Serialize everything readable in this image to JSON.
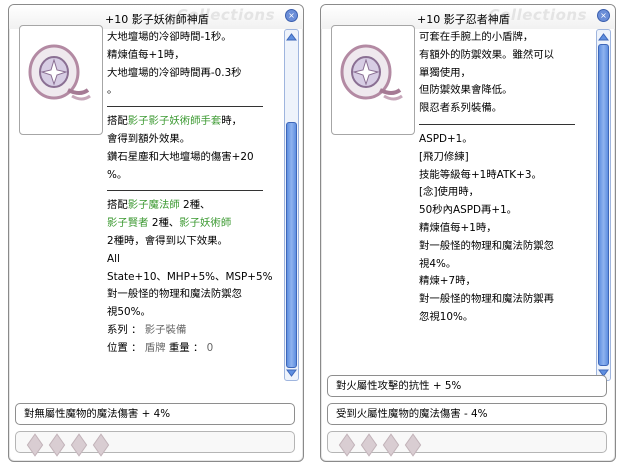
{
  "left": {
    "title": "+10 影子妖術師神盾",
    "watermark": "Collections",
    "lines": [
      {
        "t": "大地壇場的冷卻時間-1秒。"
      },
      {
        "t": "精煉值每+1時，"
      },
      {
        "t": "大地壇場的冷卻時間再-0.3秒"
      },
      {
        "t": "。"
      },
      {
        "hr": true
      },
      {
        "parts": [
          {
            "t": "搭配"
          },
          {
            "t": "影子影子妖術師手套",
            "c": "green"
          },
          {
            "t": "時，"
          }
        ]
      },
      {
        "t": "會得到額外效果。"
      },
      {
        "t": "鑽石星塵和大地壇場的傷害+20"
      },
      {
        "t": "%。"
      },
      {
        "hr": true
      },
      {
        "parts": [
          {
            "t": "搭配"
          },
          {
            "t": "影子魔法師",
            "c": "green"
          },
          {
            "t": " 2種、"
          }
        ]
      },
      {
        "parts": [
          {
            "t": "影子賢者",
            "c": "green"
          },
          {
            "t": " 2種、"
          },
          {
            "t": "影子妖術師",
            "c": "green"
          }
        ]
      },
      {
        "t": "2種時，會得到以下效果。"
      },
      {
        "t": "All"
      },
      {
        "t": "State+10、MHP+5%、MSP+5%。"
      },
      {
        "t": "對一般怪的物理和魔法防禦忽"
      },
      {
        "t": "視50%。"
      },
      {
        "parts": [
          {
            "t": "系列 ： "
          },
          {
            "t": "影子裝備",
            "c": "gray"
          }
        ]
      },
      {
        "parts": [
          {
            "t": "位置 ： "
          },
          {
            "t": "盾牌",
            "c": "gray"
          },
          {
            "t": "  重量 ： "
          },
          {
            "t": "0",
            "c": "gray"
          }
        ]
      }
    ],
    "bar1": "對無屬性魔物的魔法傷害 + 4%",
    "bar2": ""
  },
  "right": {
    "title": "+10 影子忍者神盾",
    "watermark": "Collections",
    "lines": [
      {
        "t": "可套在手腕上的小盾牌，"
      },
      {
        "t": "有額外的防禦效果。雖然可以"
      },
      {
        "t": "單獨使用，"
      },
      {
        "t": "但防禦效果會降低。"
      },
      {
        "t": "限忍者系列裝備。"
      },
      {
        "hr": true
      },
      {
        "t": "ASPD+1。"
      },
      {
        "t": "[飛刀修練]"
      },
      {
        "t": "技能等級每+1時ATK+3。"
      },
      {
        "t": "[念]使用時，"
      },
      {
        "t": "50秒內ASPD再+1。"
      },
      {
        "t": "精煉值每+1時，"
      },
      {
        "t": "對一般怪的物理和魔法防禦忽"
      },
      {
        "t": "視4%。"
      },
      {
        "t": "精煉+7時，"
      },
      {
        "t": "對一般怪的物理和魔法防禦再"
      },
      {
        "t": "忽視10%。"
      }
    ],
    "bar1": "對火屬性攻擊的抗性 + 5%",
    "bar2": "受到火屬性魔物的魔法傷害 - 4%"
  },
  "colors": {
    "green": "#3c9a32",
    "scroll": "#5f8fe0"
  },
  "icons": [
    "close-icon",
    "scroll-up-arrow-icon",
    "scroll-down-arrow-icon",
    "card-slot-icon"
  ]
}
